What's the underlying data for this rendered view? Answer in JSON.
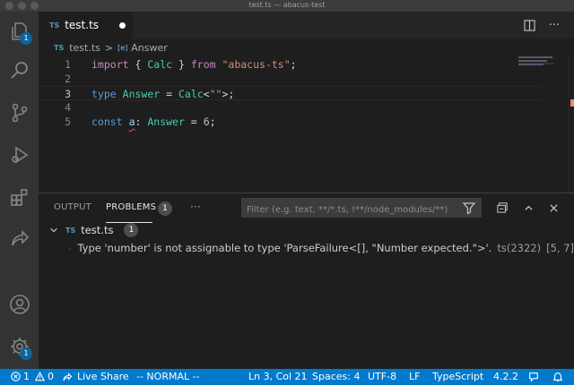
{
  "window": {
    "title": "test.ts — abacus-test"
  },
  "activity_bar": {
    "explorer_badge": "1",
    "manage_badge": "1"
  },
  "tabs": [
    {
      "icon": "TS",
      "label": "test.ts",
      "dirty": true
    }
  ],
  "breadcrumb": {
    "file_icon": "TS",
    "file": "test.ts",
    "separator": ">",
    "symbol_icon": "[e]",
    "symbol": "Answer"
  },
  "editor": {
    "line_numbers": [
      "1",
      "2",
      "3",
      "4",
      "5"
    ],
    "lines": {
      "l1": {
        "import": "import",
        "open": "{ ",
        "name": "Calc",
        "close": " }",
        "from": "from",
        "module": "\"abacus-ts\"",
        "semi": ";"
      },
      "l3": {
        "type": "type",
        "name": "Answer",
        "eq": " = ",
        "calc": "Calc",
        "open": "<",
        "str": "\"\"",
        "close": ">;"
      },
      "l5": {
        "const": "const",
        "var": "a",
        "colon": ": ",
        "type": "Answer",
        "eq": " = ",
        "num": "6",
        "semi": ";"
      }
    },
    "current_line": 3
  },
  "panel": {
    "tabs": {
      "output": "OUTPUT",
      "problems": "PROBLEMS"
    },
    "problems_count": "1",
    "more": "···",
    "filter_placeholder": "Filter (e.g. text, **/*.ts, !**/node_modules/**)",
    "file": {
      "icon": "TS",
      "name": "test.ts",
      "count": "1"
    },
    "error": {
      "message": "Type 'number' is not assignable to type 'ParseFailure<[], \"Number expected.\">'.",
      "code": "ts(2322)",
      "position": "[5, 7]"
    }
  },
  "status_bar": {
    "errors": "1",
    "warnings": "0",
    "live_share": "Live Share",
    "mode": "-- NORMAL --",
    "cursor": "Ln 3, Col 21",
    "spaces": "Spaces: 4",
    "encoding": "UTF-8",
    "eol": "LF",
    "language": "TypeScript",
    "ts_version": "4.2.2",
    "color": "#007acc"
  },
  "colors": {
    "error": "#f14c4c",
    "accent": "#007acc",
    "ts_icon": "#519aba"
  }
}
